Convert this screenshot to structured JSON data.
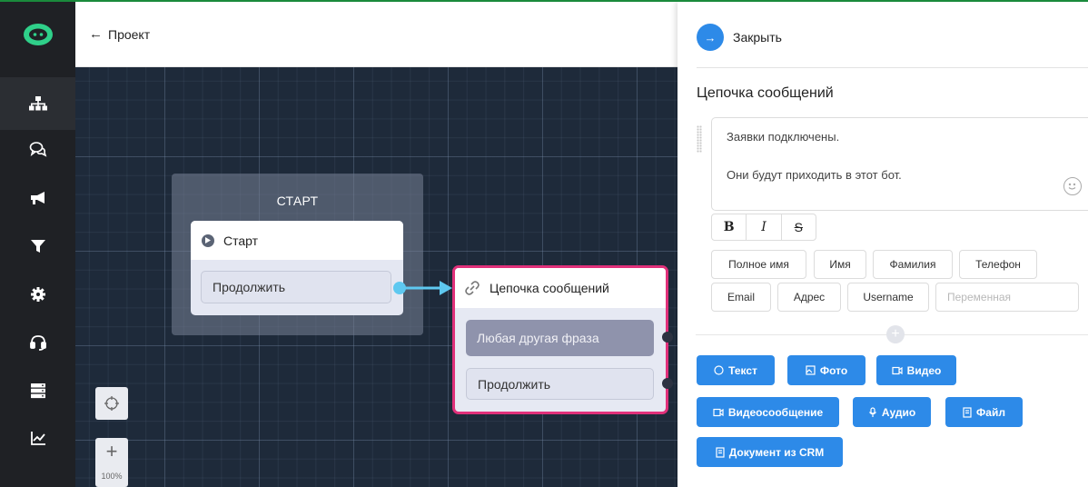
{
  "header": {
    "back_icon": "arrow-left-icon",
    "back_glyph": "←",
    "title": "Проект"
  },
  "sidebar": {
    "logo_icon": "bot-logo-icon",
    "items": [
      {
        "icon": "sitemap-icon",
        "active": true
      },
      {
        "icon": "chat-bubbles-icon",
        "active": false
      },
      {
        "icon": "megaphone-icon",
        "active": false
      },
      {
        "icon": "filter-icon",
        "active": false
      },
      {
        "icon": "gear-icon",
        "active": false
      },
      {
        "icon": "headset-icon",
        "active": false
      },
      {
        "icon": "database-icon",
        "active": false
      },
      {
        "icon": "analytics-chart-icon",
        "active": false
      }
    ]
  },
  "canvas": {
    "group_title": "СТАРТ",
    "start_node": {
      "title": "Старт",
      "button": "Продолжить"
    },
    "chain_node": {
      "title": "Цепочка сообщений",
      "button_any": "Любая другая фраза",
      "button_continue": "Продолжить"
    },
    "zoom": {
      "level": "100%",
      "plus": "+"
    }
  },
  "panel": {
    "close_label": "Закрыть",
    "close_glyph": "→",
    "section_title": "Цепочка сообщений",
    "message_lines": [
      "Заявки подключены.",
      "Они будут приходить в этот бот."
    ],
    "format": {
      "bold": "B",
      "italic": "I",
      "strike": "S"
    },
    "variables": [
      "Полное имя",
      "Имя",
      "Фамилия",
      "Телефон",
      "Email",
      "Адрес",
      "Username"
    ],
    "variable_placeholder": "Переменная",
    "add_glyph": "+",
    "add_buttons": [
      "Текст",
      "Фото",
      "Видео",
      "Видеосообщение",
      "Аудио",
      "Файл",
      "Документ из CRM"
    ]
  },
  "colors": {
    "accent": "#2d8ae8",
    "selected_border": "#e0307a",
    "sidebar_bg": "#1f2125",
    "canvas_bg": "#1e2a3a",
    "connector": "#5ec8f0"
  }
}
